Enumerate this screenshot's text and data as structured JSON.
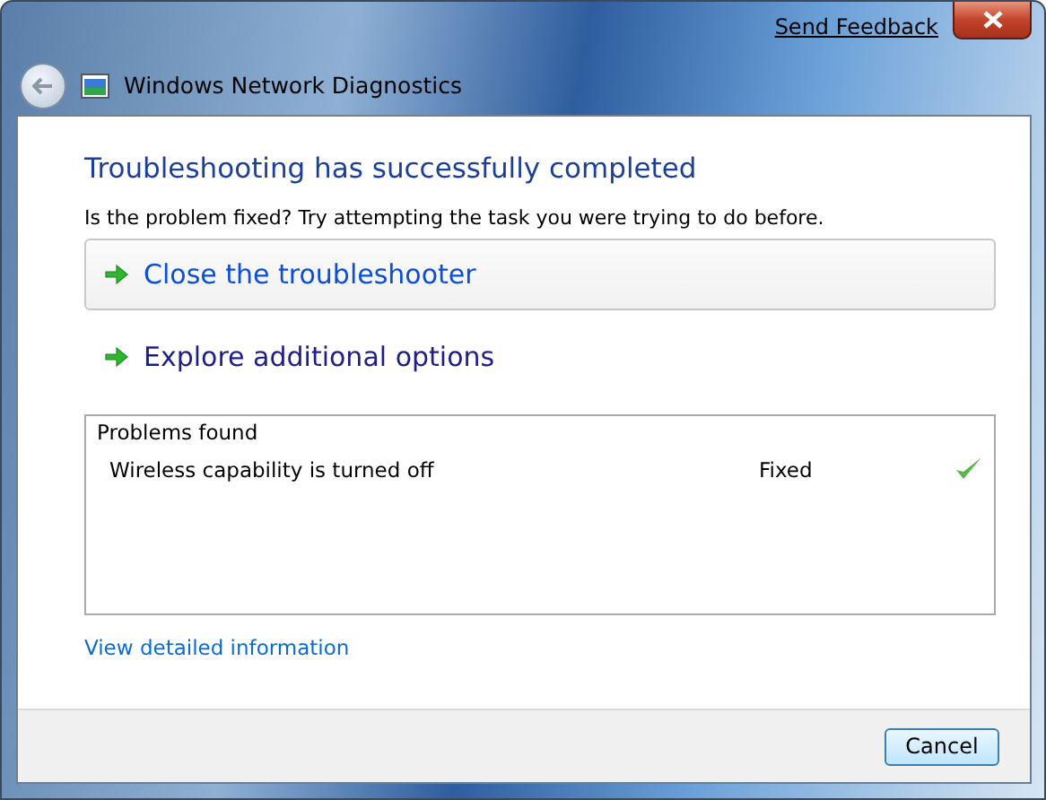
{
  "window": {
    "title": "Windows Network Diagnostics",
    "feedback_link": "Send Feedback"
  },
  "heading": "Troubleshooting has successfully completed",
  "question": "Is the problem fixed?  Try attempting the task you were trying to do before.",
  "command_links": [
    {
      "label": "Close the troubleshooter",
      "hovered": true
    },
    {
      "label": "Explore additional options",
      "hovered": false
    }
  ],
  "problems": {
    "title": "Problems found",
    "rows": [
      {
        "name": "Wireless capability is turned off",
        "status": "Fixed"
      }
    ]
  },
  "details_link": "View detailed information",
  "buttons": [
    "Cancel"
  ]
}
